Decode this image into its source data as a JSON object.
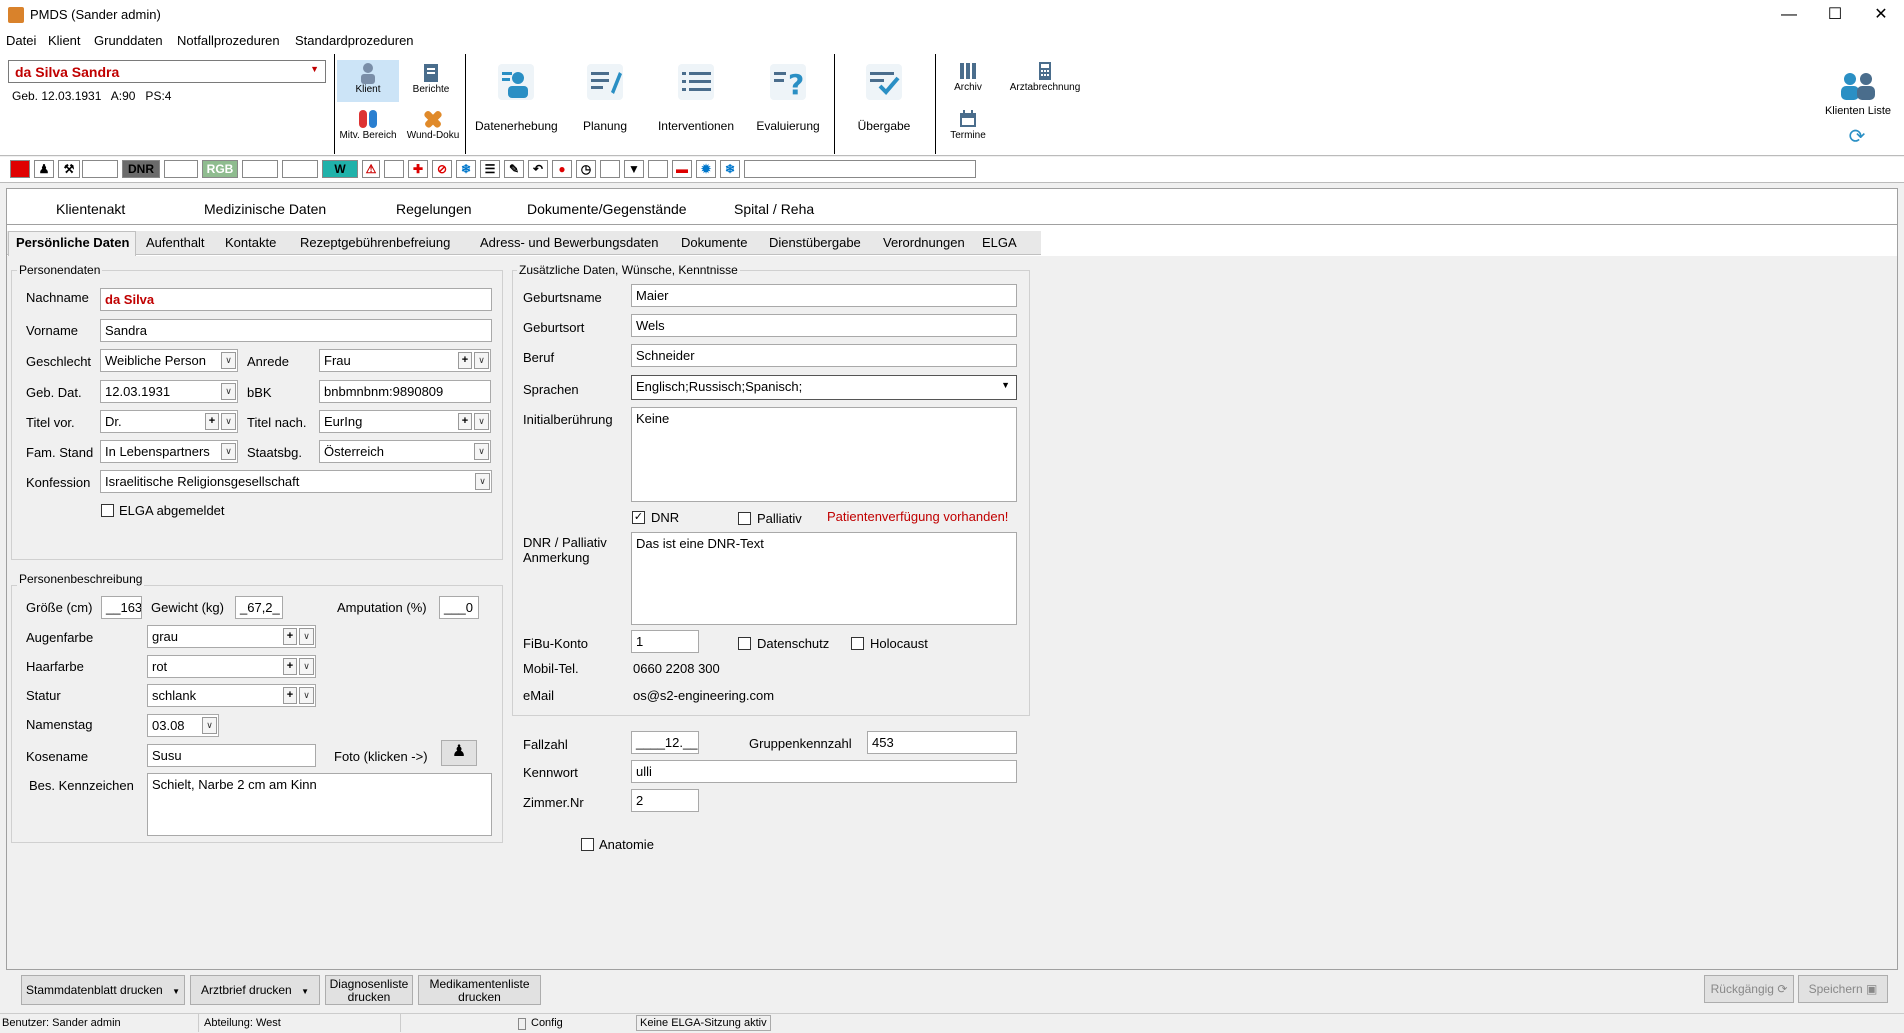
{
  "window": {
    "title": "PMDS (Sander admin)"
  },
  "menu": [
    "Datei",
    "Klient",
    "Grunddaten",
    "Notfallprozeduren",
    "Standardprozeduren"
  ],
  "client": {
    "name": "da Silva Sandra",
    "info": "Geb. 12.03.1931   A:90   PS:4"
  },
  "toolbar": {
    "klient": "Klient",
    "berichte": "Berichte",
    "mitv": "Mitv. Bereich",
    "wund": "Wund-Doku",
    "datenerhebung": "Datenerhebung",
    "planung": "Planung",
    "interventionen": "Interventionen",
    "evaluierung": "Evaluierung",
    "uebergabe": "Übergabe",
    "archiv": "Archiv",
    "termine": "Termine",
    "arztabrechnung": "Arztabrechnung",
    "klienten_liste": "Klienten Liste"
  },
  "strip": {
    "dnr": "DNR",
    "rgb": "RGB",
    "w": "W"
  },
  "main_tabs": [
    "Klientenakt",
    "Medizinische Daten",
    "Regelungen",
    "Dokumente/Gegenstände",
    "Spital / Reha"
  ],
  "sub_tabs": [
    "Persönliche Daten",
    "Aufenthalt",
    "Kontakte",
    "Rezeptgebührenbefreiung",
    "Adress- und Bewerbungsdaten",
    "Dokumente",
    "Dienstübergabe",
    "Verordnungen",
    "ELGA"
  ],
  "personendaten": {
    "title": "Personendaten",
    "nachname_label": "Nachname",
    "nachname": "da Silva",
    "vorname_label": "Vorname",
    "vorname": "Sandra",
    "geschlecht_label": "Geschlecht",
    "geschlecht": "Weibliche Person",
    "anrede_label": "Anrede",
    "anrede": "Frau",
    "gebdat_label": "Geb. Dat.",
    "gebdat": "12.03.1931",
    "bbk_label": "bBK",
    "bbk": "bnbmnbnm:9890809",
    "titelvor_label": "Titel vor.",
    "titelvor": "Dr.",
    "titelnach_label": "Titel nach.",
    "titelnach": "EurIng",
    "famstand_label": "Fam. Stand",
    "famstand": "In Lebenspartners",
    "staatsbg_label": "Staatsbg.",
    "staatsbg": "Österreich",
    "konfession_label": "Konfession",
    "konfession": "Israelitische Religionsgesellschaft",
    "elga_label": "ELGA abgemeldet"
  },
  "personenbeschreibung": {
    "title": "Personenbeschreibung",
    "groesse_label": "Größe (cm)",
    "groesse": "__163",
    "gewicht_label": "Gewicht (kg)",
    "gewicht": "_67,2_",
    "amputation_label": "Amputation (%)",
    "amputation": "___0",
    "augenfarbe_label": "Augenfarbe",
    "augenfarbe": "grau",
    "haarfarbe_label": "Haarfarbe",
    "haarfarbe": "rot",
    "statur_label": "Statur",
    "statur": "schlank",
    "namenstag_label": "Namenstag",
    "namenstag": "03.08",
    "kosename_label": "Kosename",
    "kosename": "Susu",
    "foto_label": "Foto (klicken ->)",
    "kennzeichen_label": "Bes. Kennzeichen",
    "kennzeichen": "Schielt, Narbe 2 cm am Kinn"
  },
  "zusatz": {
    "title": "Zusätzliche Daten, Wünsche, Kenntnisse",
    "geburtsname_label": "Geburtsname",
    "geburtsname": "Maier",
    "geburtsort_label": "Geburtsort",
    "geburtsort": "Wels",
    "beruf_label": "Beruf",
    "beruf": "Schneider",
    "sprachen_label": "Sprachen",
    "sprachen": "Englisch;Russisch;Spanisch;",
    "initial_label": "Initialberührung",
    "initial": "Keine",
    "dnr_label": "DNR",
    "palliativ_label": "Palliativ",
    "verfuegung": "Patientenverfügung vorhanden!",
    "dnr_anm_label1": "DNR / Palliativ",
    "dnr_anm_label2": "Anmerkung",
    "dnr_anm": "Das ist eine DNR-Text",
    "fibu_label": "FiBu-Konto",
    "fibu": "1",
    "datenschutz_label": "Datenschutz",
    "holocaust_label": "Holocaust",
    "mobil_label": "Mobil-Tel.",
    "mobil": "0660 2208 300",
    "email_label": "eMail",
    "email": "os@s2-engineering.com"
  },
  "fall": {
    "fallzahl_label": "Fallzahl",
    "fallzahl": "____12.__",
    "gruppe_label": "Gruppenkennzahl",
    "gruppe": "453",
    "kennwort_label": "Kennwort",
    "kennwort": "ulli",
    "zimmer_label": "Zimmer.Nr",
    "zimmer": "2",
    "anatomie_label": "Anatomie"
  },
  "bottom": {
    "stammdaten": "Stammdatenblatt drucken",
    "arztbrief": "Arztbrief drucken",
    "diag1": "Diagnosenliste",
    "diag2": "drucken",
    "medi1": "Medikamentenliste",
    "medi2": "drucken",
    "rueck": "Rückgängig",
    "speichern": "Speichern"
  },
  "status": {
    "benutzer": "Benutzer: Sander admin",
    "abteilung": "Abteilung: West",
    "config": "Config",
    "elga": "Keine ELGA-Sitzung aktiv"
  },
  "colors": {
    "accent": "#2a8fc4",
    "danger": "#c00000",
    "rgb_bg": "#8fbc8f",
    "w_bg": "#20b2aa"
  }
}
